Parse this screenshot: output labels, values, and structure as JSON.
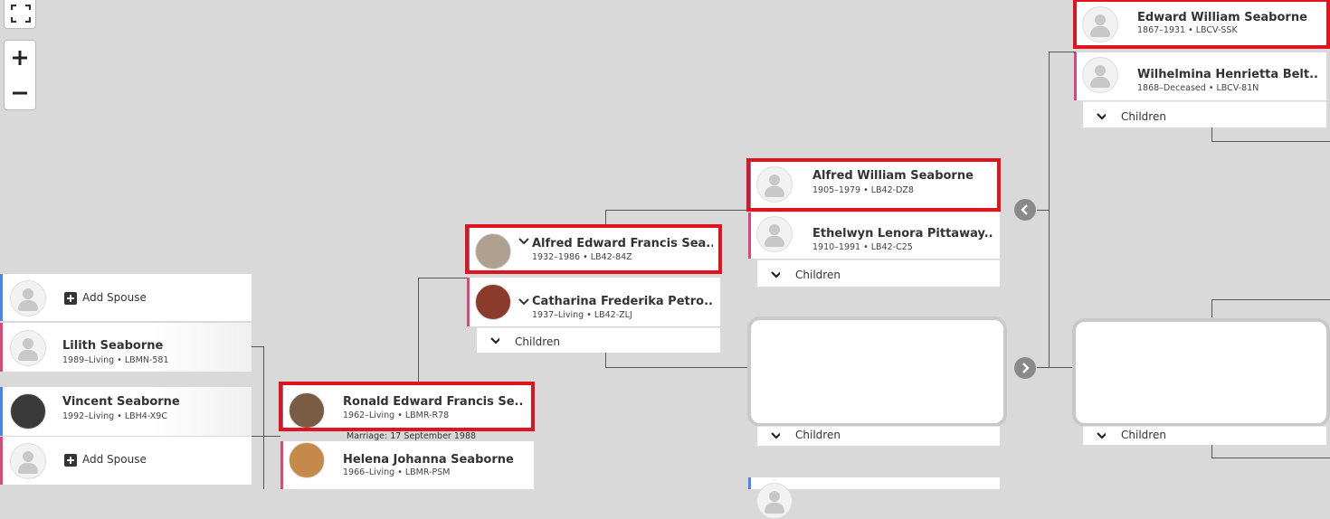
{
  "controls": {
    "fullscreen_icon": "fullscreen-icon",
    "zoom_in_icon": "plus-icon",
    "zoom_out_icon": "minus-icon"
  },
  "children_label": "Children",
  "add_spouse_label": "Add Spouse",
  "marriage_text": "Marriage: 17 September 1988",
  "people": {
    "lilith": {
      "name": "Lilith Seaborne",
      "meta": "1989–Living • LBMN-581"
    },
    "vincent": {
      "name": "Vincent Seaborne",
      "meta": "1992–Living • LBH4-X9C"
    },
    "ronald": {
      "name": "Ronald Edward Francis Se...",
      "meta": "1962–Living • LBMR-R78"
    },
    "helena": {
      "name": "Helena Johanna Seaborne",
      "meta": "1966–Living • LBMR-PSM"
    },
    "alfred_ef": {
      "name": "Alfred Edward Francis Sea...",
      "meta": "1932–1986 • LB42-84Z"
    },
    "catharina": {
      "name": "Catharina Frederika Petro...",
      "meta": "1937–Living • LB42-ZLJ"
    },
    "alfred_w": {
      "name": "Alfred William Seaborne",
      "meta": "1905–1979 • LB42-DZ8"
    },
    "ethelwyn": {
      "name": "Ethelwyn Lenora Pittaway...",
      "meta": "1910–1991 • LB42-C25"
    },
    "edward_w": {
      "name": "Edward William Seaborne",
      "meta": "1867–1931 • LBCV-SSK"
    },
    "wilhelmina": {
      "name": "Wilhelmina Henrietta Belt...",
      "meta": "1868–Deceased • LBCV-81N"
    }
  },
  "colors": {
    "highlight": "#e0141e",
    "male": "#4a86e8",
    "female": "#d9487a",
    "background": "#d9d9d9"
  }
}
